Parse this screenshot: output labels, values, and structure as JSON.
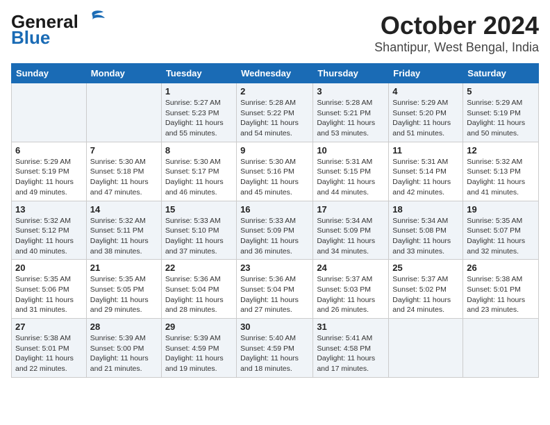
{
  "header": {
    "logo_line1": "General",
    "logo_line2": "Blue",
    "title": "October 2024",
    "subtitle": "Shantipur, West Bengal, India"
  },
  "calendar": {
    "days_of_week": [
      "Sunday",
      "Monday",
      "Tuesday",
      "Wednesday",
      "Thursday",
      "Friday",
      "Saturday"
    ],
    "weeks": [
      [
        {
          "day": "",
          "info": ""
        },
        {
          "day": "",
          "info": ""
        },
        {
          "day": "1",
          "info": "Sunrise: 5:27 AM\nSunset: 5:23 PM\nDaylight: 11 hours and 55 minutes."
        },
        {
          "day": "2",
          "info": "Sunrise: 5:28 AM\nSunset: 5:22 PM\nDaylight: 11 hours and 54 minutes."
        },
        {
          "day": "3",
          "info": "Sunrise: 5:28 AM\nSunset: 5:21 PM\nDaylight: 11 hours and 53 minutes."
        },
        {
          "day": "4",
          "info": "Sunrise: 5:29 AM\nSunset: 5:20 PM\nDaylight: 11 hours and 51 minutes."
        },
        {
          "day": "5",
          "info": "Sunrise: 5:29 AM\nSunset: 5:19 PM\nDaylight: 11 hours and 50 minutes."
        }
      ],
      [
        {
          "day": "6",
          "info": "Sunrise: 5:29 AM\nSunset: 5:19 PM\nDaylight: 11 hours and 49 minutes."
        },
        {
          "day": "7",
          "info": "Sunrise: 5:30 AM\nSunset: 5:18 PM\nDaylight: 11 hours and 47 minutes."
        },
        {
          "day": "8",
          "info": "Sunrise: 5:30 AM\nSunset: 5:17 PM\nDaylight: 11 hours and 46 minutes."
        },
        {
          "day": "9",
          "info": "Sunrise: 5:30 AM\nSunset: 5:16 PM\nDaylight: 11 hours and 45 minutes."
        },
        {
          "day": "10",
          "info": "Sunrise: 5:31 AM\nSunset: 5:15 PM\nDaylight: 11 hours and 44 minutes."
        },
        {
          "day": "11",
          "info": "Sunrise: 5:31 AM\nSunset: 5:14 PM\nDaylight: 11 hours and 42 minutes."
        },
        {
          "day": "12",
          "info": "Sunrise: 5:32 AM\nSunset: 5:13 PM\nDaylight: 11 hours and 41 minutes."
        }
      ],
      [
        {
          "day": "13",
          "info": "Sunrise: 5:32 AM\nSunset: 5:12 PM\nDaylight: 11 hours and 40 minutes."
        },
        {
          "day": "14",
          "info": "Sunrise: 5:32 AM\nSunset: 5:11 PM\nDaylight: 11 hours and 38 minutes."
        },
        {
          "day": "15",
          "info": "Sunrise: 5:33 AM\nSunset: 5:10 PM\nDaylight: 11 hours and 37 minutes."
        },
        {
          "day": "16",
          "info": "Sunrise: 5:33 AM\nSunset: 5:09 PM\nDaylight: 11 hours and 36 minutes."
        },
        {
          "day": "17",
          "info": "Sunrise: 5:34 AM\nSunset: 5:09 PM\nDaylight: 11 hours and 34 minutes."
        },
        {
          "day": "18",
          "info": "Sunrise: 5:34 AM\nSunset: 5:08 PM\nDaylight: 11 hours and 33 minutes."
        },
        {
          "day": "19",
          "info": "Sunrise: 5:35 AM\nSunset: 5:07 PM\nDaylight: 11 hours and 32 minutes."
        }
      ],
      [
        {
          "day": "20",
          "info": "Sunrise: 5:35 AM\nSunset: 5:06 PM\nDaylight: 11 hours and 31 minutes."
        },
        {
          "day": "21",
          "info": "Sunrise: 5:35 AM\nSunset: 5:05 PM\nDaylight: 11 hours and 29 minutes."
        },
        {
          "day": "22",
          "info": "Sunrise: 5:36 AM\nSunset: 5:04 PM\nDaylight: 11 hours and 28 minutes."
        },
        {
          "day": "23",
          "info": "Sunrise: 5:36 AM\nSunset: 5:04 PM\nDaylight: 11 hours and 27 minutes."
        },
        {
          "day": "24",
          "info": "Sunrise: 5:37 AM\nSunset: 5:03 PM\nDaylight: 11 hours and 26 minutes."
        },
        {
          "day": "25",
          "info": "Sunrise: 5:37 AM\nSunset: 5:02 PM\nDaylight: 11 hours and 24 minutes."
        },
        {
          "day": "26",
          "info": "Sunrise: 5:38 AM\nSunset: 5:01 PM\nDaylight: 11 hours and 23 minutes."
        }
      ],
      [
        {
          "day": "27",
          "info": "Sunrise: 5:38 AM\nSunset: 5:01 PM\nDaylight: 11 hours and 22 minutes."
        },
        {
          "day": "28",
          "info": "Sunrise: 5:39 AM\nSunset: 5:00 PM\nDaylight: 11 hours and 21 minutes."
        },
        {
          "day": "29",
          "info": "Sunrise: 5:39 AM\nSunset: 4:59 PM\nDaylight: 11 hours and 19 minutes."
        },
        {
          "day": "30",
          "info": "Sunrise: 5:40 AM\nSunset: 4:59 PM\nDaylight: 11 hours and 18 minutes."
        },
        {
          "day": "31",
          "info": "Sunrise: 5:41 AM\nSunset: 4:58 PM\nDaylight: 11 hours and 17 minutes."
        },
        {
          "day": "",
          "info": ""
        },
        {
          "day": "",
          "info": ""
        }
      ]
    ]
  }
}
